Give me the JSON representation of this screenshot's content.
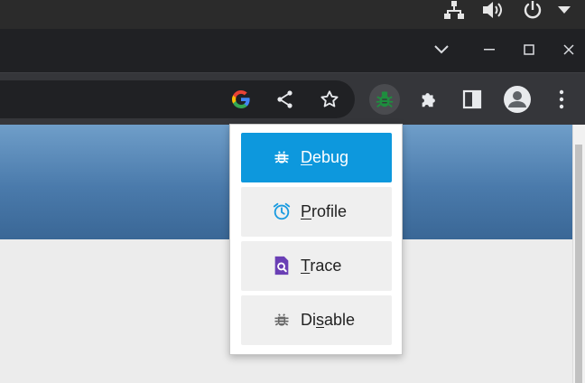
{
  "os_bar": {
    "icons": [
      "network-icon",
      "volume-icon",
      "power-icon",
      "dropdown-arrow-icon"
    ]
  },
  "window_controls": {
    "icons": [
      "tab-search-chevron-icon",
      "minimize-icon",
      "maximize-icon",
      "close-icon"
    ]
  },
  "toolbar": {
    "icons": [
      "google-icon",
      "share-icon",
      "bookmark-star-icon",
      "debugger-extension-icon",
      "extensions-puzzle-icon",
      "side-panel-icon",
      "profile-avatar-icon",
      "menu-kebab-icon"
    ],
    "active_extension_color": "#1e8e3e"
  },
  "popup": {
    "items": [
      {
        "pre": "",
        "u": "D",
        "post": "ebug",
        "icon": "bug-icon",
        "selected": true
      },
      {
        "pre": "",
        "u": "P",
        "post": "rofile",
        "icon": "alarm-clock-icon",
        "selected": false
      },
      {
        "pre": "",
        "u": "T",
        "post": "race",
        "icon": "trace-search-icon",
        "selected": false
      },
      {
        "pre": "Di",
        "u": "s",
        "post": "able",
        "icon": "bug-disabled-icon",
        "selected": false
      }
    ],
    "colors": {
      "selected_bg": "#0d98dd",
      "item_bg": "#efefef",
      "profile_icon": "#1a9be0",
      "trace_icon": "#6a3fb5",
      "disable_icon": "#666666"
    }
  }
}
